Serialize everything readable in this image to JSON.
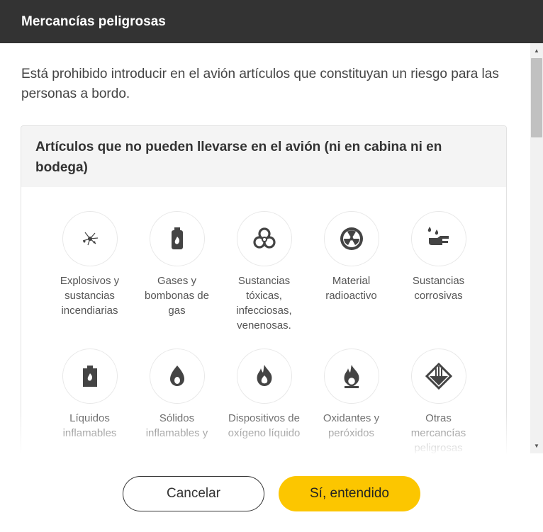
{
  "dialog": {
    "title": "Mercancías peligrosas",
    "intro": "Está prohibido introducir en el avión artículos que constituyan un riesgo para las personas a bordo.",
    "card_title": "Artículos que no pueden llevarse en el avión (ni en cabina ni en bodega)",
    "items": [
      {
        "label": "Explosivos y sustancias incendiarias",
        "icon": "explosive-icon"
      },
      {
        "label": "Gases y bombonas de gas",
        "icon": "gas-cylinder-icon"
      },
      {
        "label": "Sustancias tóxicas, infecciosas, venenosas.",
        "icon": "biohazard-icon"
      },
      {
        "label": "Material radioactivo",
        "icon": "radioactive-icon"
      },
      {
        "label": "Sustancias corrosivas",
        "icon": "corrosive-icon"
      },
      {
        "label": "Líquidos inflamables",
        "icon": "flammable-liquid-icon"
      },
      {
        "label": "Sólidos inflamables y",
        "icon": "flammable-solid-icon"
      },
      {
        "label": "Dispositivos de oxígeno líquido",
        "icon": "liquid-oxygen-icon"
      },
      {
        "label": "Oxidantes y peróxidos",
        "icon": "oxidizer-icon"
      },
      {
        "label": "Otras mercancías peligrosas",
        "icon": "misc-dangerous-icon"
      }
    ],
    "buttons": {
      "cancel": "Cancelar",
      "confirm": "Sí, entendido"
    }
  },
  "colors": {
    "header_bg": "#333333",
    "accent": "#fcc600",
    "icon": "#444444"
  }
}
